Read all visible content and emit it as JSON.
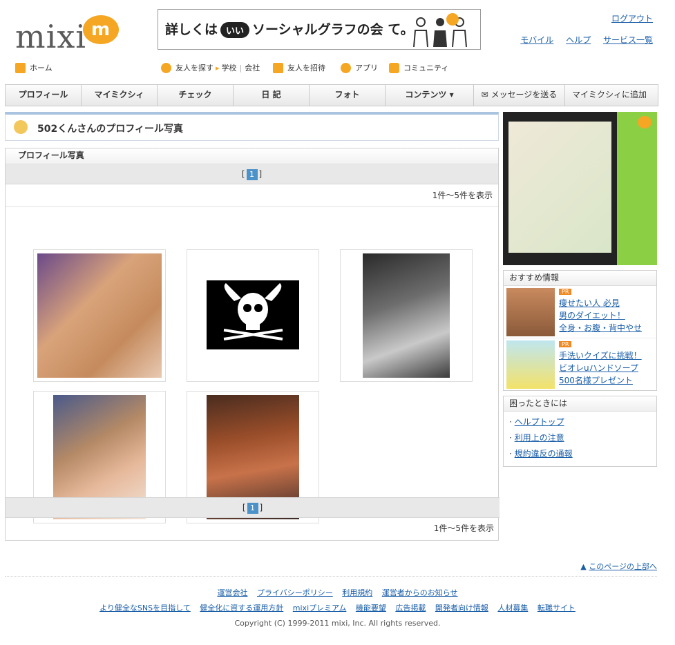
{
  "logo": {
    "text": "mixi"
  },
  "banner": {
    "text_before": "詳しくは",
    "bubble": "いい",
    "text_after": "ソーシャルグラフの会 て。"
  },
  "top_links": {
    "logout": "ログアウト",
    "mobile": "モバイル",
    "help": "ヘルプ",
    "services": "サービス一覧"
  },
  "subnav": {
    "home": "ホーム",
    "find_friends": "友人を探す",
    "school": "学校",
    "company": "会社",
    "invite": "友人を招待",
    "apps": "アプリ",
    "community": "コミュニティ"
  },
  "tabs": [
    "プロフィール",
    "マイミクシィ",
    "チェック",
    "日 記",
    "フォト",
    "コンテンツ ▾",
    "✉ メッセージを送る",
    "マイミクシィに追加"
  ],
  "page_title": "502くんさんのプロフィール写真",
  "photo_section": {
    "heading": "プロフィール写真",
    "pager_left": "[",
    "pager_page": "1",
    "pager_right": "]",
    "count_text": "1件〜5件を表示"
  },
  "recommend": {
    "heading": "おすすめ情報",
    "items": [
      {
        "badge": "PR",
        "lines": [
          "痩せたい人 必見",
          "男のダイエット！",
          "全身・お腹・背中やせ"
        ]
      },
      {
        "badge": "PR",
        "lines": [
          "手洗いクイズに挑戦！",
          "ビオレuハンドソープ",
          "500名様プレゼント"
        ]
      }
    ]
  },
  "help_box": {
    "heading": "困ったときには",
    "links": [
      "ヘルプトップ",
      "利用上の注意",
      "規約違反の通報"
    ]
  },
  "page_top_link": "このページの上部へ",
  "footer": {
    "row1": [
      "運営会社",
      "プライバシーポリシー",
      "利用規約",
      "運営者からのお知らせ"
    ],
    "row2": [
      "より健全なSNSを目指して",
      "健全化に資する運用方針",
      "mixiプレミアム",
      "機能要望",
      "広告掲載",
      "開発者向け情報",
      "人材募集",
      "転職サイト"
    ],
    "copyright": "Copyright (C) 1999-2011 mixi, Inc. All rights reserved."
  },
  "colors": {
    "link": "#1a5ea8",
    "page_indicator": "#4c91c8",
    "logo_orange": "#f5a623",
    "ad_green": "#8bcf45"
  }
}
